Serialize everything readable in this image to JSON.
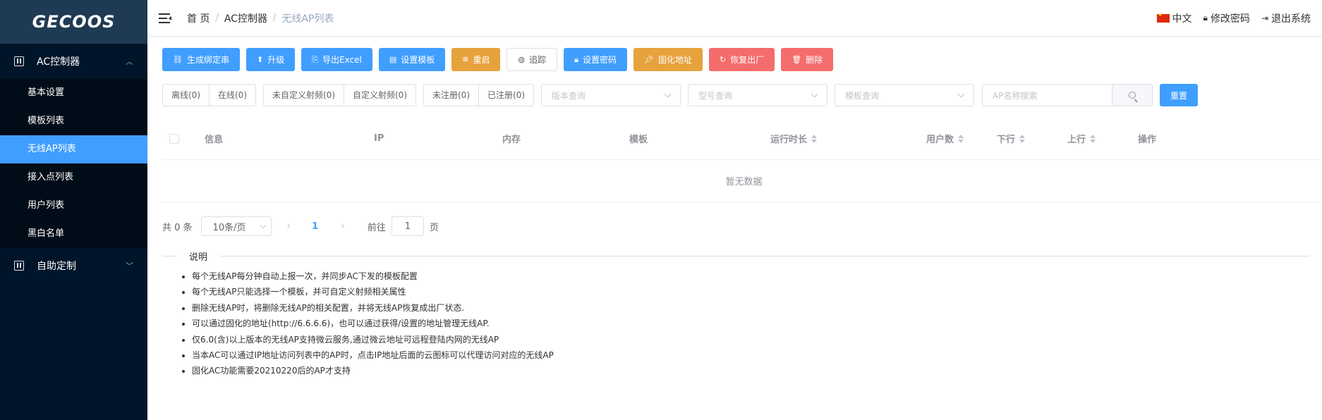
{
  "sidebar": {
    "logo": "GECOOS",
    "groups": [
      {
        "label": "AC控制器",
        "expanded": true,
        "items": [
          {
            "label": "基本设置",
            "active": false
          },
          {
            "label": "模板列表",
            "active": false
          },
          {
            "label": "无线AP列表",
            "active": true
          },
          {
            "label": "接入点列表",
            "active": false
          },
          {
            "label": "用户列表",
            "active": false
          },
          {
            "label": "黑白名单",
            "active": false
          }
        ]
      },
      {
        "label": "自助定制",
        "expanded": false
      }
    ]
  },
  "header": {
    "breadcrumb": [
      "首 页",
      "AC控制器",
      "无线AP列表"
    ],
    "language": "中文",
    "change_password": "修改密码",
    "logout": "退出系统"
  },
  "toolbar": [
    {
      "label": "生成绑定串",
      "color": "blue",
      "icon": "link-icon"
    },
    {
      "label": "升级",
      "color": "blue",
      "icon": "upload-icon"
    },
    {
      "label": "导出Excel",
      "color": "blue",
      "icon": "export-icon"
    },
    {
      "label": "设置模板",
      "color": "blue",
      "icon": "document-icon"
    },
    {
      "label": "重启",
      "color": "orange",
      "icon": "restart-icon"
    },
    {
      "label": "追踪",
      "color": "plain",
      "icon": "globe-icon"
    },
    {
      "label": "设置密码",
      "color": "blue",
      "icon": "lock-icon"
    },
    {
      "label": "固化地址",
      "color": "orange",
      "icon": "pin-icon"
    },
    {
      "label": "恢复出厂",
      "color": "red",
      "icon": "refresh-icon"
    },
    {
      "label": "删除",
      "color": "red",
      "icon": "trash-icon"
    }
  ],
  "filters": {
    "status": [
      "离线(0)",
      "在线(0)"
    ],
    "rf": [
      "未自定义射频(0)",
      "自定义射频(0)"
    ],
    "register": [
      "未注册(0)",
      "已注册(0)"
    ],
    "version_placeholder": "版本查询",
    "model_placeholder": "型号查询",
    "template_placeholder": "模板查询",
    "search_placeholder": "AP名称搜索",
    "reset": "重置"
  },
  "table": {
    "columns": [
      "信息",
      "IP",
      "内存",
      "模板",
      "运行时长",
      "用户数",
      "下行",
      "上行",
      "操作"
    ],
    "empty_text": "暂无数据"
  },
  "pagination": {
    "total": "共 0 条",
    "page_size": "10条/页",
    "current_page": "1",
    "goto_prefix": "前往",
    "goto_value": "1",
    "goto_suffix": "页"
  },
  "notes": {
    "title": "说明",
    "items": [
      "每个无线AP每分钟自动上报一次，并同步AC下发的模板配置",
      "每个无线AP只能选择一个模板，并可自定义射频相关属性",
      "删除无线AP时，将删除无线AP的相关配置，并将无线AP恢复成出厂状态.",
      "可以通过固化的地址(http://6.6.6.6)，也可以通过获得/设置的地址管理无线AP.",
      "仅6.0(含)以上版本的无线AP支持微云服务,通过微云地址可远程登陆内网的无线AP",
      "当本AC可以通过IP地址访问列表中的AP时，点击IP地址后面的云图标可以代理访问对应的无线AP",
      "固化AC功能需要20210220后的AP才支持"
    ]
  },
  "colors": {
    "primary": "#409eff",
    "warning": "#e6a23c",
    "danger": "#f56c6c",
    "sidebar_bg": "#001529"
  }
}
